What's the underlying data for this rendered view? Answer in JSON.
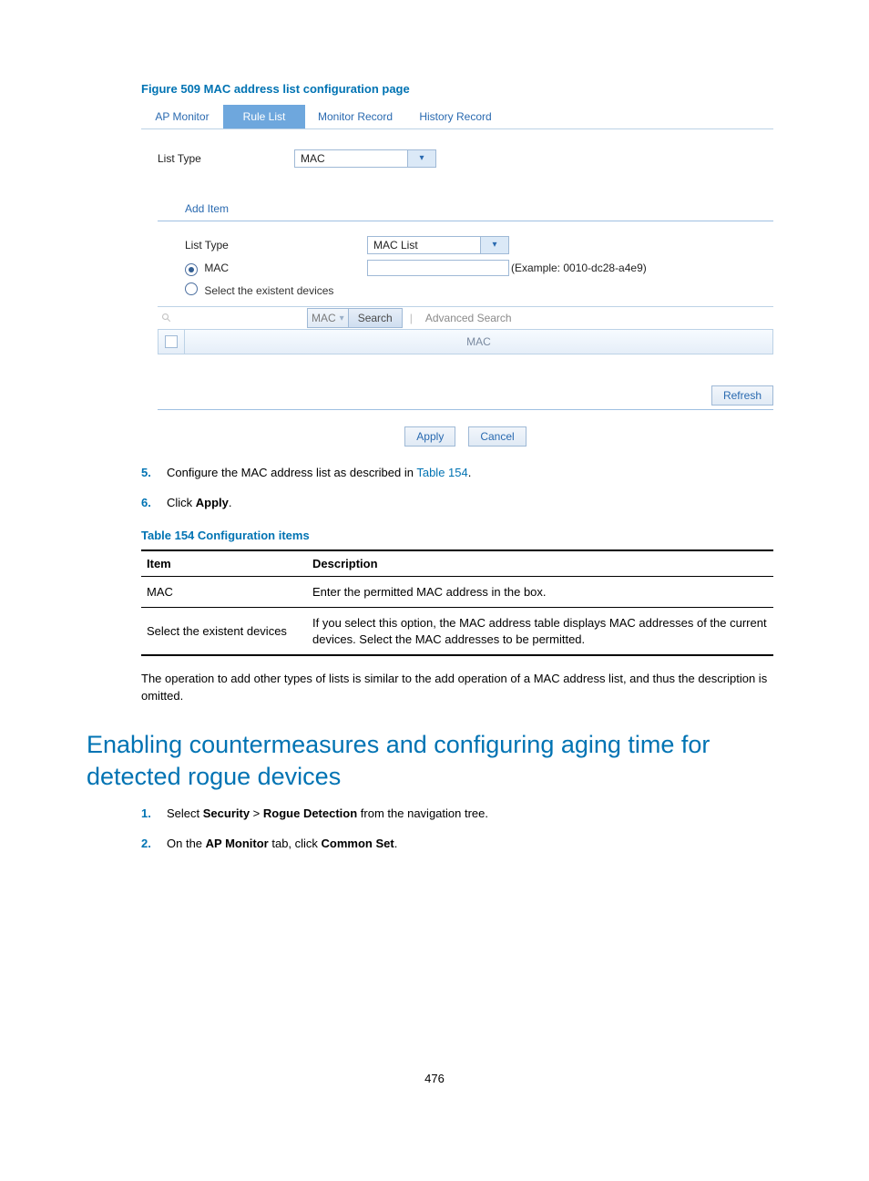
{
  "figure_caption": "Figure 509 MAC address list configuration page",
  "tabs": {
    "ap_monitor": "AP Monitor",
    "rule_list": "Rule List",
    "monitor_record": "Monitor Record",
    "history_record": "History Record"
  },
  "outer": {
    "list_type_label": "List Type",
    "list_type_value": "MAC"
  },
  "add_item_title": "Add Item",
  "inner_form": {
    "list_type_label": "List Type",
    "list_type_value": "MAC List",
    "mac_radio_label": "MAC",
    "mac_input_value": "",
    "mac_example": "(Example: 0010-dc28-a4e9)",
    "select_devices_label": "Select the existent devices"
  },
  "search": {
    "field_select": "MAC",
    "search_btn": "Search",
    "advanced": "Advanced Search",
    "column_header": "MAC"
  },
  "buttons": {
    "refresh": "Refresh",
    "apply": "Apply",
    "cancel": "Cancel"
  },
  "steps_a": [
    {
      "num": "5.",
      "pre": "Configure the MAC address list as described in ",
      "link": "Table 154",
      "post": "."
    },
    {
      "num": "6.",
      "pre": "Click ",
      "bold": "Apply",
      "post": "."
    }
  ],
  "table_caption": "Table 154 Configuration items",
  "table": {
    "head_item": "Item",
    "head_desc": "Description",
    "rows": [
      {
        "item": "MAC",
        "desc": "Enter the permitted MAC address in the box."
      },
      {
        "item": "Select the existent devices",
        "desc": "If you select this option, the MAC address table displays MAC addresses of the current devices. Select the MAC addresses to be permitted."
      }
    ]
  },
  "after_table_para": "The operation to add other types of lists is similar to the add operation of a MAC address list, and thus the description is omitted.",
  "section_heading": "Enabling countermeasures and configuring aging time for detected rogue devices",
  "steps_b": [
    {
      "num": "1.",
      "parts": [
        "Select ",
        "<b>Security</b>",
        " > ",
        "<b>Rogue Detection</b>",
        " from the navigation tree."
      ]
    },
    {
      "num": "2.",
      "parts": [
        "On the ",
        "<b>AP Monitor</b>",
        " tab, click ",
        "<b>Common Set</b>",
        "."
      ]
    }
  ],
  "page_number": "476"
}
